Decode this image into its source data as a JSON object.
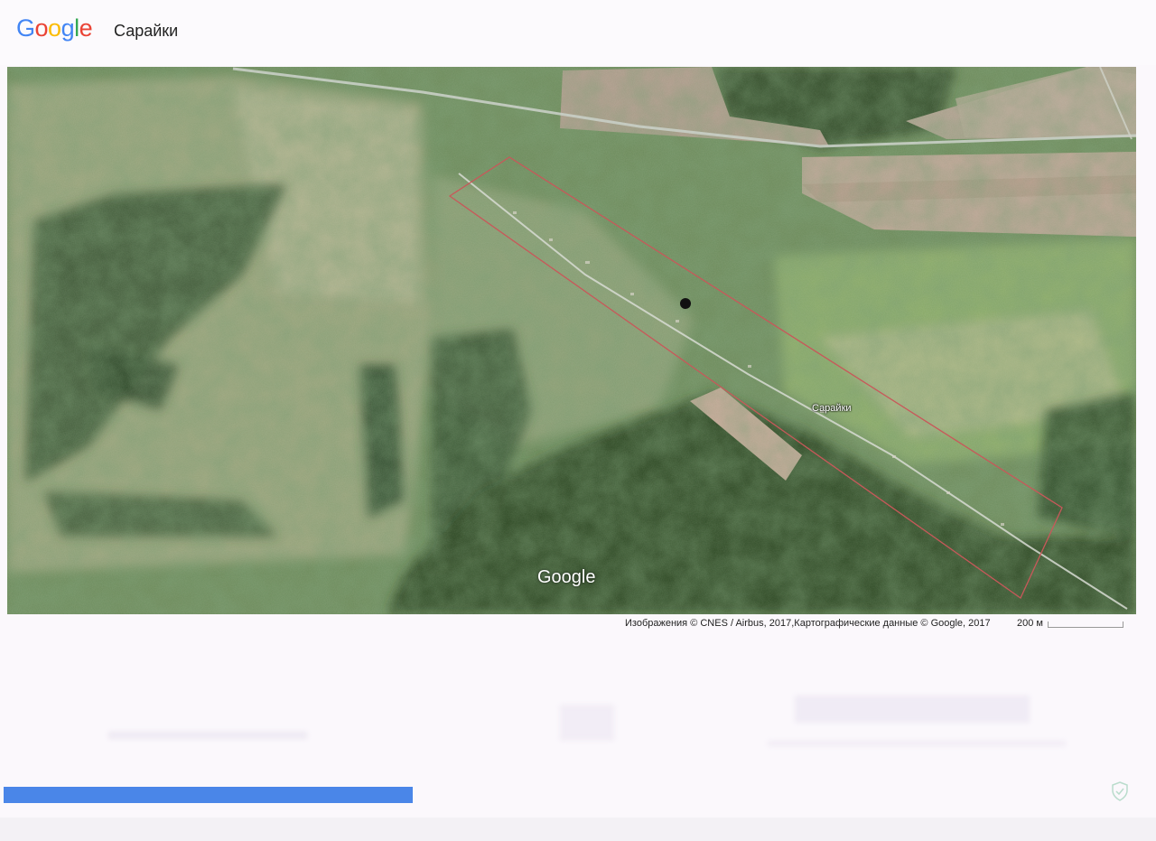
{
  "header": {
    "logo": {
      "letters": [
        {
          "ch": "G",
          "color": "#4285F4"
        },
        {
          "ch": "o",
          "color": "#EA4335"
        },
        {
          "ch": "o",
          "color": "#FBBC05"
        },
        {
          "ch": "g",
          "color": "#4285F4"
        },
        {
          "ch": "l",
          "color": "#34A853"
        },
        {
          "ch": "e",
          "color": "#EA4335"
        }
      ]
    },
    "title": "Сарайки"
  },
  "map": {
    "place_label": "Сарайки",
    "watermark": "Google",
    "marker_icon": "location-dot-icon",
    "boundary_color": "#c8585a"
  },
  "footer": {
    "attribution": "Изображения © CNES / Airbus, 2017,Картографические данные © Google, 2017",
    "scale_label": "200 м",
    "progress_color": "#4a86e8",
    "shield_icon": "shield-check-icon"
  }
}
